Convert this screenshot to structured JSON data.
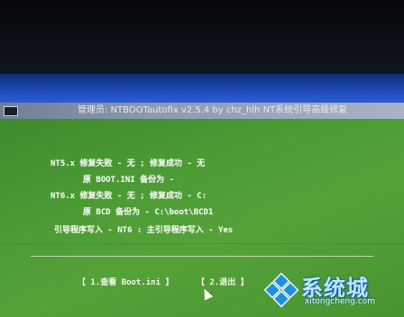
{
  "window": {
    "title": "管理员:  NTBOOTautofix v2.5.4 by chz_hlh   NT系统引导高级修复"
  },
  "log": {
    "nt5_line": "NT5.x 修复失败 - 无 ;    修复成功 - 无",
    "boot_ini_line": "原 BOOT.INI 备份为 -",
    "nt6_line": "NT6.x 修复失败 - 无 ;    修复成功 - C:",
    "bcd_line": "原 BCD 备份为 - C:\\boot\\BCD1",
    "bootloader_line": "引导程序写入 - NT6  :    主引导程序写入 - Yes"
  },
  "buttons": {
    "view_boot_ini": "【 1.查看 Boot.ini 】",
    "exit": "【 2.退出 】"
  },
  "watermark": {
    "cn": "系统城",
    "url": "xitongcheng.com"
  }
}
